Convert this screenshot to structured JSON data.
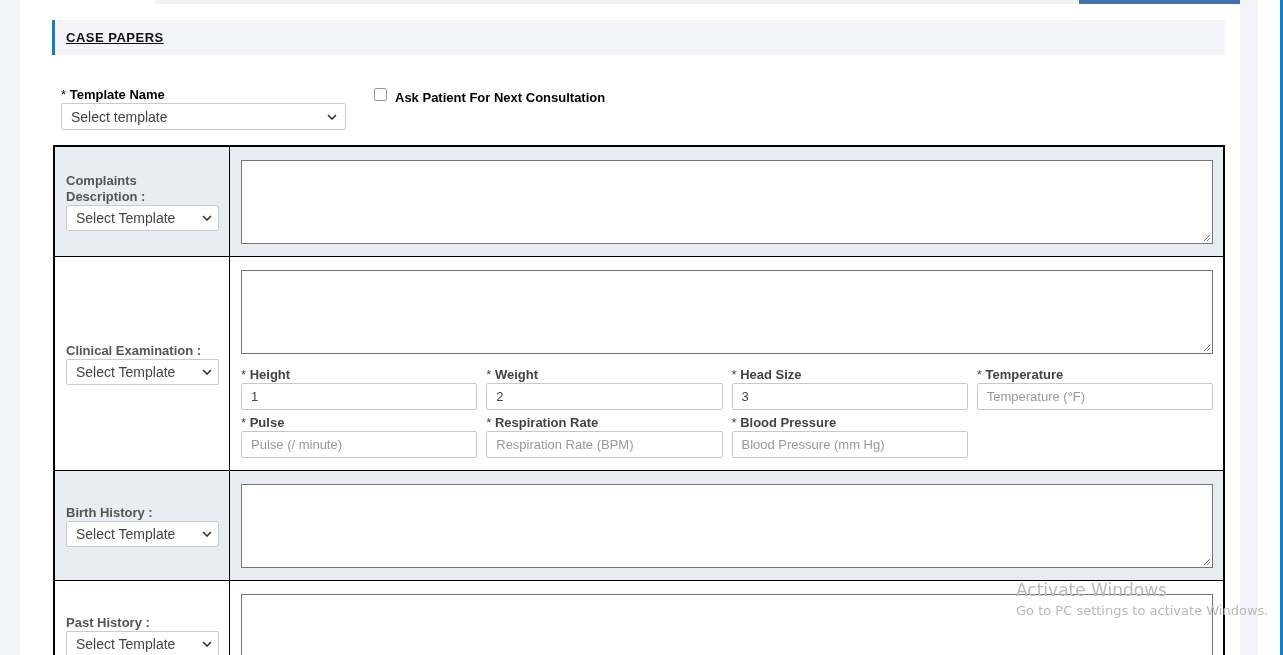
{
  "heading": "CASE PAPERS",
  "template": {
    "label": "* **Template Name**",
    "value": "Select template"
  },
  "ask_next_consultation": {
    "label": "Ask Patient For Next Consultation",
    "checked": false
  },
  "sections": [
    {
      "label": "Complaints Description :",
      "select": "Select Template"
    },
    {
      "label": "Clinical Examination :",
      "select": "Select Template",
      "vitals": [
        {
          "label": "* **Height**",
          "value": "1"
        },
        {
          "label": "* **Weight**",
          "value": "2"
        },
        {
          "label": "* **Head Size**",
          "value": "3"
        },
        {
          "label": "* **Temperature**",
          "placeholder": "Temperature (°F)"
        },
        {
          "label": "* **Pulse**",
          "placeholder": "Pulse (/ minute)"
        },
        {
          "label": "* **Respiration Rate**",
          "placeholder": "Respiration Rate (BPM)"
        },
        {
          "label": "* **Blood Pressure**",
          "placeholder": "Blood Pressure (mm Hg)"
        }
      ]
    },
    {
      "label": "Birth History :",
      "select": "Select Template"
    },
    {
      "label": "Past History :",
      "select": "Select Template"
    }
  ],
  "os_notice": {
    "title": "Activate Windows",
    "text": "Go to PC settings to activate Windows."
  }
}
